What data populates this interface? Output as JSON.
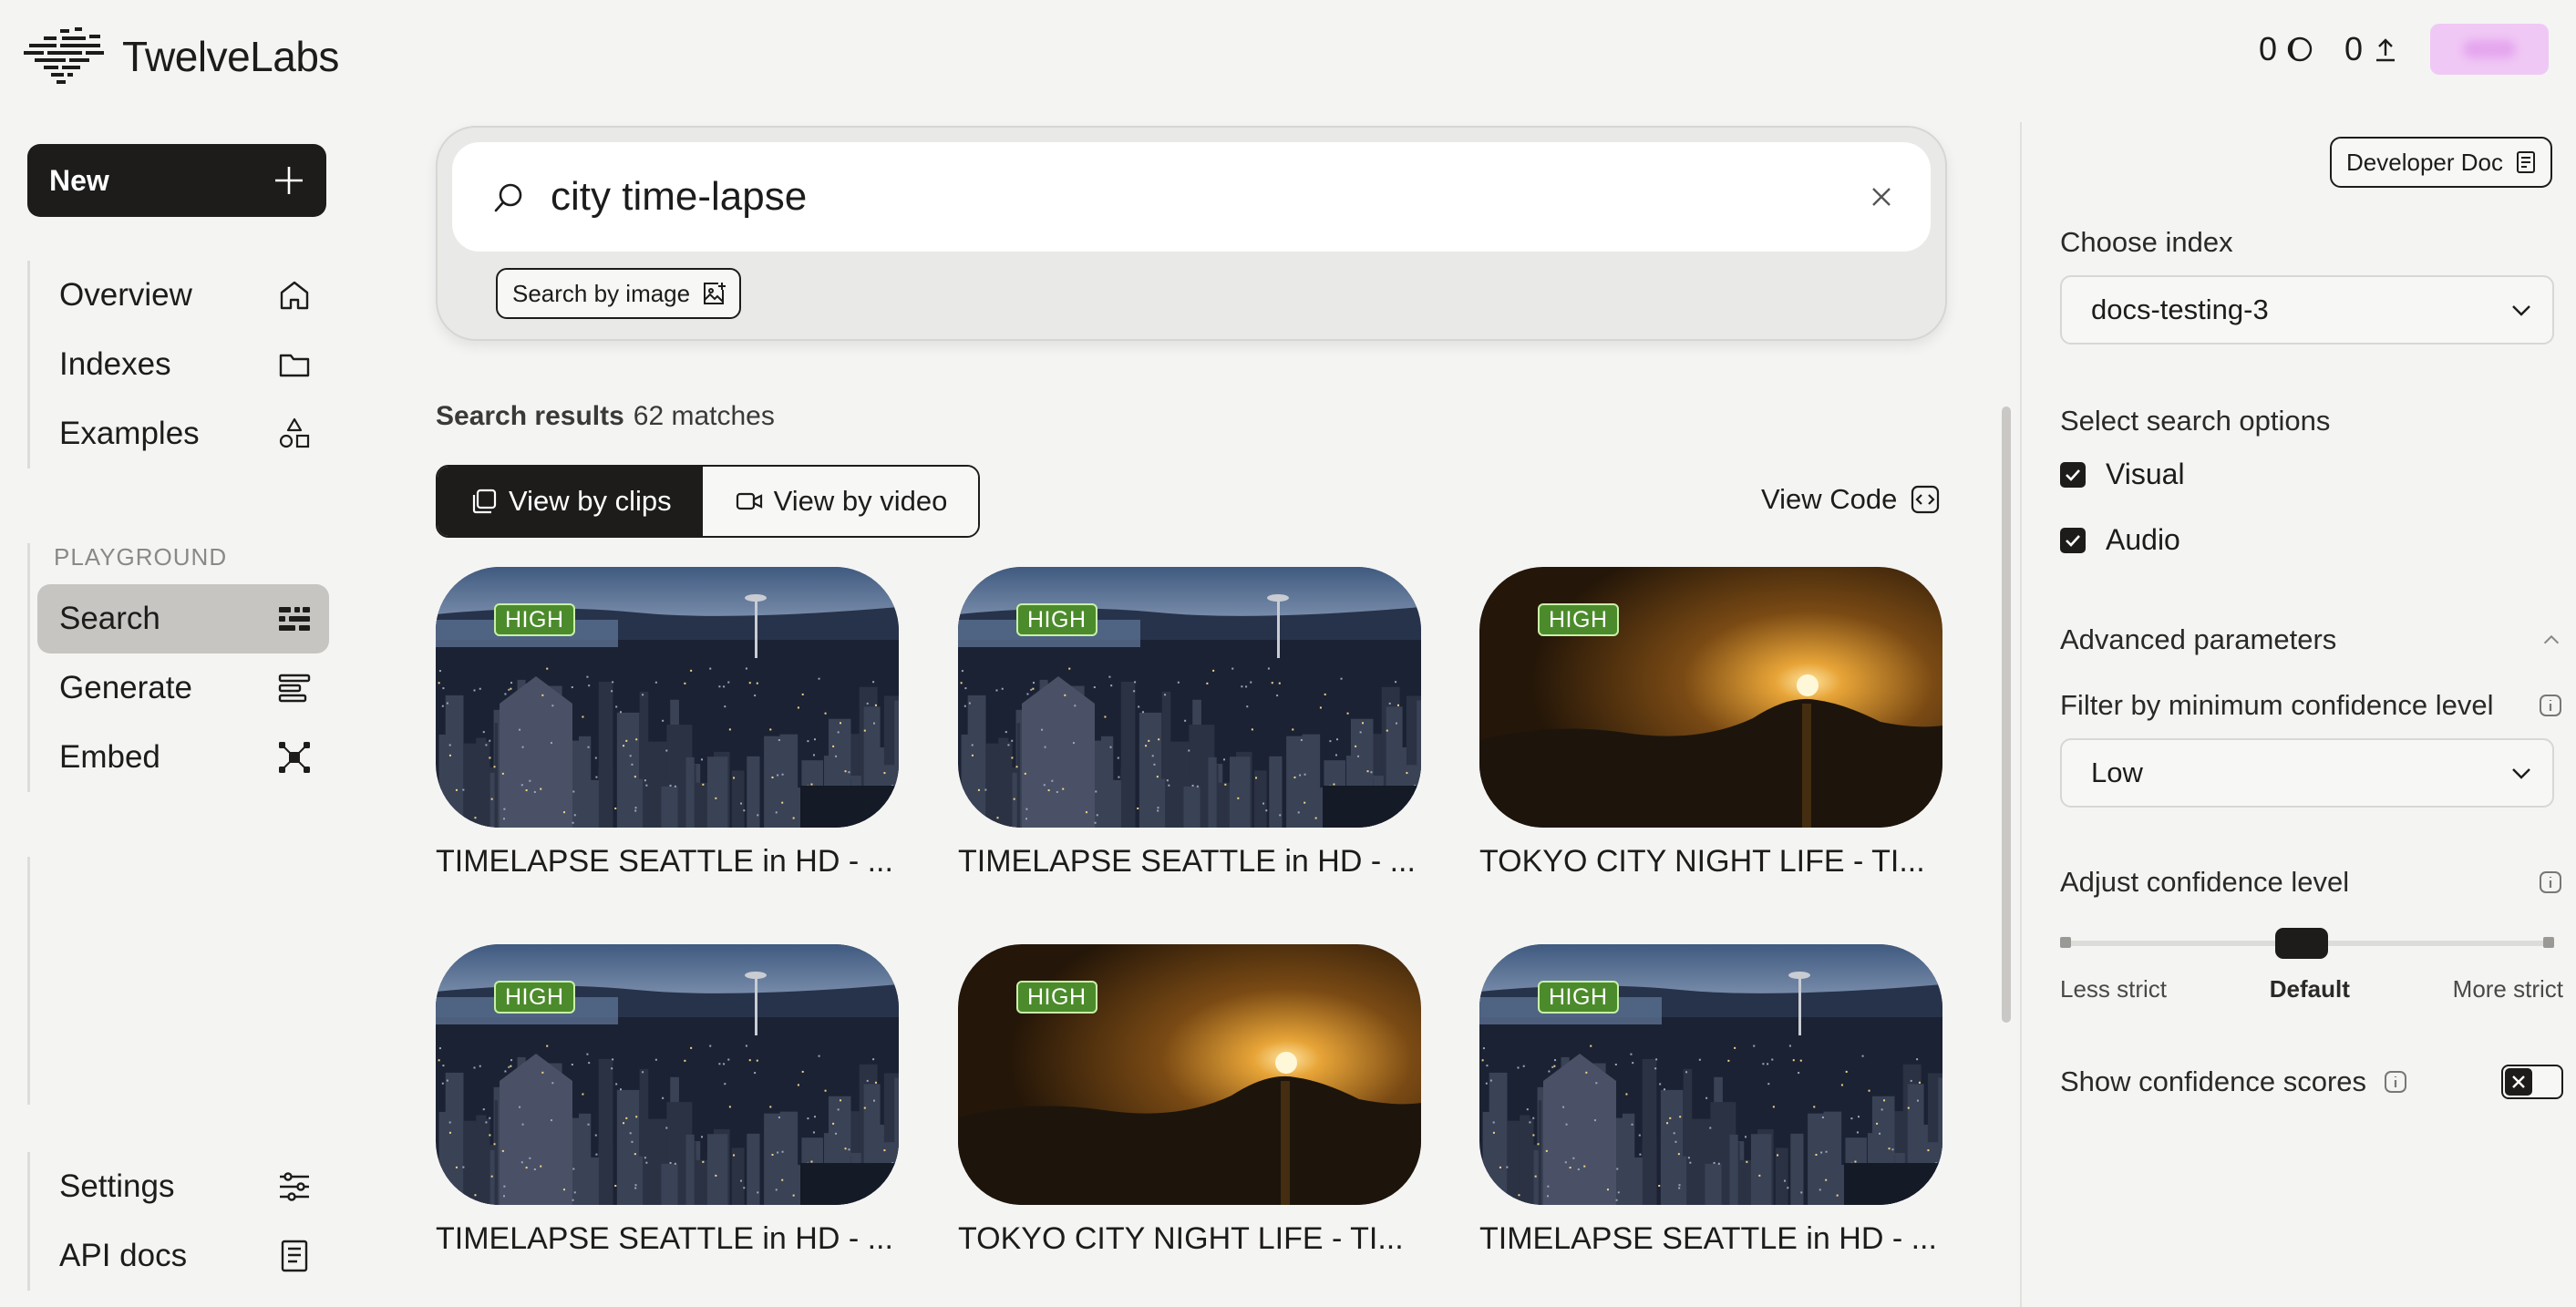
{
  "brand": {
    "name": "TwelveLabs"
  },
  "header": {
    "credits_count": "0",
    "uploads_count": "0"
  },
  "sidebar": {
    "new_label": "New",
    "primary": [
      {
        "label": "Overview",
        "icon": "home-icon"
      },
      {
        "label": "Indexes",
        "icon": "folder-icon"
      },
      {
        "label": "Examples",
        "icon": "shapes-icon"
      }
    ],
    "playground_label": "PLAYGROUND",
    "playground": [
      {
        "label": "Search",
        "icon": "search-grid-icon",
        "active": true
      },
      {
        "label": "Generate",
        "icon": "generate-lines-icon"
      },
      {
        "label": "Embed",
        "icon": "embed-nodes-icon"
      }
    ],
    "bottom": [
      {
        "label": "Settings",
        "icon": "sliders-icon"
      },
      {
        "label": "API docs",
        "icon": "document-icon"
      }
    ]
  },
  "search": {
    "query": "city time-lapse",
    "search_by_image_label": "Search by image"
  },
  "results": {
    "label": "Search results",
    "count": "62 matches",
    "view_by_clips": "View by clips",
    "view_by_video": "View by video",
    "view_code": "View Code",
    "items": [
      {
        "title": "TIMELAPSE SEATTLE in HD - ...",
        "badge": "HIGH",
        "scene": "seattle"
      },
      {
        "title": "TIMELAPSE SEATTLE in HD - ...",
        "badge": "HIGH",
        "scene": "seattle"
      },
      {
        "title": "TOKYO CITY NIGHT LIFE - TI...",
        "badge": "HIGH",
        "scene": "sunset"
      },
      {
        "title": "TIMELAPSE SEATTLE in HD - ...",
        "badge": "HIGH",
        "scene": "seattle"
      },
      {
        "title": "TOKYO CITY NIGHT LIFE - TI...",
        "badge": "HIGH",
        "scene": "sunset"
      },
      {
        "title": "TIMELAPSE SEATTLE in HD - ...",
        "badge": "HIGH",
        "scene": "seattle"
      }
    ]
  },
  "panel": {
    "developer_doc": "Developer Doc",
    "choose_index_label": "Choose index",
    "index_value": "docs-testing-3",
    "search_options_label": "Select search options",
    "option_visual": "Visual",
    "option_audio": "Audio",
    "advanced_label": "Advanced parameters",
    "filter_label": "Filter by minimum confidence level",
    "filter_value": "Low",
    "adjust_label": "Adjust confidence level",
    "slider_less": "Less strict",
    "slider_default": "Default",
    "slider_more": "More strict",
    "slider_value": "Default",
    "show_scores_label": "Show confidence scores"
  }
}
